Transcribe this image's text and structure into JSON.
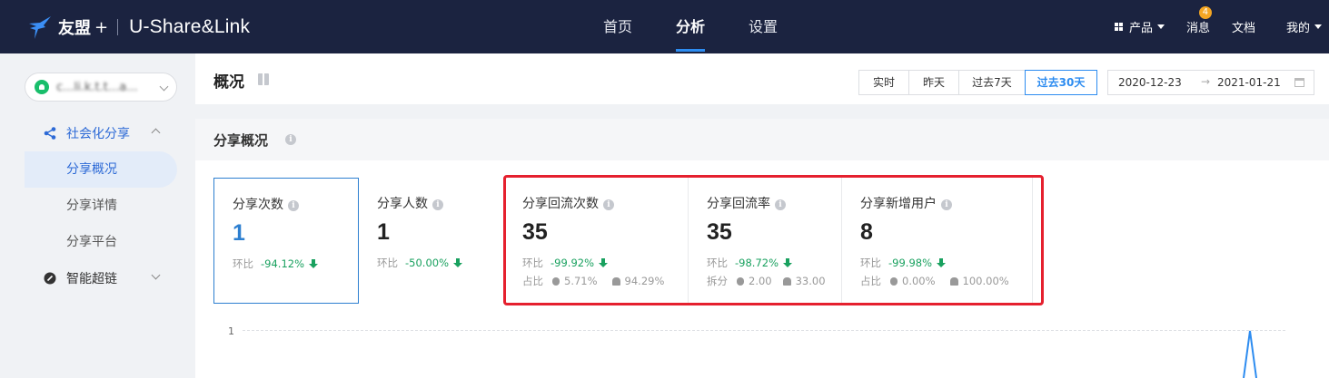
{
  "topbar": {
    "logo_cn": "友盟",
    "logo_plus": "+",
    "logo_en": "U-Share&Link",
    "nav": [
      "首页",
      "分析",
      "设置"
    ],
    "nav_active": "分析",
    "right": {
      "product": "产品",
      "messages": "消息",
      "messages_badge": "4",
      "docs": "文档",
      "mine": "我的"
    }
  },
  "sidebar": {
    "app_select_value": "c...li.k.t.t...a...",
    "groups": [
      {
        "label": "社会化分享",
        "expanded": true,
        "color": "#2d6ad6",
        "items": [
          "分享概况",
          "分享详情",
          "分享平台"
        ],
        "active_item": "分享概况"
      },
      {
        "label": "智能超链",
        "expanded": false,
        "color": "#333333"
      }
    ]
  },
  "page": {
    "title": "概况",
    "ranges": [
      "实时",
      "昨天",
      "过去7天",
      "过去30天"
    ],
    "active_range": "过去30天",
    "date_start": "2020-12-23",
    "date_arrow": "→",
    "date_end": "2021-01-21"
  },
  "section": {
    "title": "分享概况",
    "metrics": [
      {
        "label": "分享次数",
        "value": "1",
        "ring_label": "环比",
        "ring_value": "-94.12%"
      },
      {
        "label": "分享人数",
        "value": "1",
        "ring_label": "环比",
        "ring_value": "-50.00%"
      },
      {
        "label": "分享回流次数",
        "value": "35",
        "ring_label": "环比",
        "ring_value": "-99.92%",
        "split_label": "占比",
        "ios": "5.71%",
        "android": "94.29%"
      },
      {
        "label": "分享回流率",
        "value": "35",
        "ring_label": "环比",
        "ring_value": "-98.72%",
        "split_label": "拆分",
        "ios": "2.00",
        "android": "33.00"
      },
      {
        "label": "分享新增用户",
        "value": "8",
        "ring_label": "环比",
        "ring_value": "-99.98%",
        "split_label": "占比",
        "ios": "0.00%",
        "android": "100.00%"
      }
    ]
  },
  "chart_data": {
    "type": "line",
    "y_tick_labels": [
      "1"
    ],
    "grid": true,
    "series_color": "#2d8cf0"
  },
  "colors": {
    "nav_bg": "#1b2340",
    "accent": "#2d8cf0",
    "highlight": "#e5202e",
    "decrease": "#19a15f"
  }
}
